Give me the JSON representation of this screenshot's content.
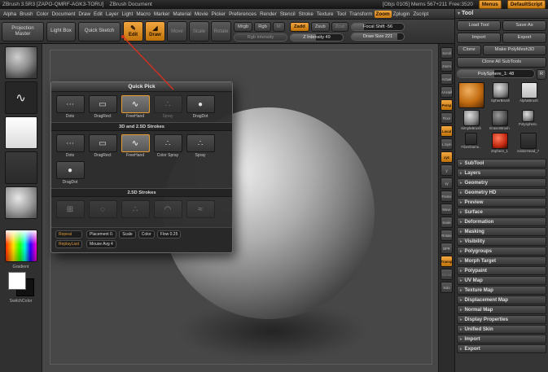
{
  "accent": "#e89a2a",
  "titlebar": {
    "title_left": "ZBrush 3.5R3 [ZAPO-QMRF-AGK3-TORU]",
    "title_doc": "ZBrush Document",
    "title_stats": "[Objs 0105] Mems 567+211 Free:3520",
    "menus_button": "Menus",
    "script_button": "DefaultScript"
  },
  "menubar": {
    "items": [
      {
        "label": "Alpha"
      },
      {
        "label": "Brush"
      },
      {
        "label": "Color"
      },
      {
        "label": "Document"
      },
      {
        "label": "Draw"
      },
      {
        "label": "Edit"
      },
      {
        "label": "Layer"
      },
      {
        "label": "Light"
      },
      {
        "label": "Macro"
      },
      {
        "label": "Marker"
      },
      {
        "label": "Material"
      },
      {
        "label": "Movie"
      },
      {
        "label": "Picker"
      },
      {
        "label": "Preferences"
      },
      {
        "label": "Render"
      },
      {
        "label": "Stencil"
      },
      {
        "label": "Stroke"
      },
      {
        "label": "Texture"
      },
      {
        "label": "Tool"
      },
      {
        "label": "Transform"
      },
      {
        "label": "Zoom",
        "cls": "active"
      },
      {
        "label": "Zplugin"
      },
      {
        "label": "Zscript"
      }
    ]
  },
  "toolbar": {
    "projection_master": "Projection Master",
    "light_box": "Light Box",
    "quick_sketch": "Quick Sketch",
    "modes": [
      {
        "label": "Edit",
        "glyph": "✎",
        "cls": "orange"
      },
      {
        "label": "Draw",
        "glyph": "◢",
        "cls": "orange"
      },
      {
        "label": "Move",
        "cls": "dim"
      },
      {
        "label": "Scale",
        "cls": "dim"
      },
      {
        "label": "Rotate",
        "cls": "dim"
      }
    ],
    "paint_buttons": [
      {
        "label": "Mrgb"
      },
      {
        "label": "Rgb"
      },
      {
        "label": "M",
        "cls": "dim"
      }
    ],
    "rgb_intensity": "Rgb Intensity",
    "sculpt_buttons": [
      {
        "label": "Zadd",
        "cls": "orange"
      },
      {
        "label": "Zsub"
      },
      {
        "label": "Zcut",
        "cls": "dim"
      }
    ],
    "z_intensity": "Z Intensity 49",
    "focal_shift": "Focal Shift -56",
    "draw_size": "Draw Size 221"
  },
  "left_shelf": {
    "stroke_glyph": "∿",
    "gradient_label": "Gradient",
    "switch_label": "SwitchColor"
  },
  "popup": {
    "title": "Quick Pick",
    "quick_row": [
      {
        "label": "Dots",
        "glyph": "⋯"
      },
      {
        "label": "DragRect",
        "glyph": "▭"
      },
      {
        "label": "FreeHand",
        "glyph": "∿",
        "cls": "selected"
      },
      {
        "label": "Spray",
        "glyph": "∴",
        "cls": "dim"
      },
      {
        "label": "DragDot",
        "glyph": "●"
      }
    ],
    "section_3d": "3D and 2.5D Strokes",
    "row_3d": [
      {
        "label": "Dots",
        "glyph": "⋯"
      },
      {
        "label": "DragRect",
        "glyph": "▭"
      },
      {
        "label": "FreeHand",
        "glyph": "∿",
        "cls": "selected"
      },
      {
        "label": "Color Spray",
        "glyph": "∴"
      },
      {
        "label": "Spray",
        "glyph": "∴"
      },
      {
        "label": "DragDot",
        "glyph": "●"
      }
    ],
    "section_25d": "2.5D Strokes",
    "row_25d": [
      {
        "label": "",
        "glyph": "⊞",
        "cls": "dim"
      },
      {
        "label": "",
        "glyph": "◌",
        "cls": "dim"
      },
      {
        "label": "",
        "glyph": "∴",
        "cls": "dim"
      },
      {
        "label": "",
        "glyph": "◠",
        "cls": "dim"
      },
      {
        "label": "",
        "glyph": "≈",
        "cls": "dim"
      }
    ],
    "footer": {
      "repeat": "Repeat",
      "replay": "ReplayLast",
      "placement": "Placement 0.",
      "scale": "Scale",
      "color": "Color",
      "flow": "Flow 0.25",
      "mouse_avg": "Mouse Avg 4"
    }
  },
  "right_strip": {
    "items": [
      {
        "label": "Scroll"
      },
      {
        "label": "Zoom"
      },
      {
        "label": "Actual"
      },
      {
        "label": "AAHalf"
      },
      {
        "label": "Persp",
        "cls": "active"
      },
      {
        "label": "Floor"
      },
      {
        "label": "Local",
        "cls": "active"
      },
      {
        "label": "L.Sym"
      },
      {
        "label": "xyz",
        "cls": "active"
      },
      {
        "label": "y"
      },
      {
        "label": "xy"
      },
      {
        "label": "Frame"
      },
      {
        "label": "Move"
      },
      {
        "label": "Scale"
      },
      {
        "label": "Rotate"
      },
      {
        "label": "BPR"
      },
      {
        "label": "Transp",
        "cls": "active"
      },
      {
        "label": "Ghost",
        "cls": "dim"
      },
      {
        "label": "Solo"
      }
    ]
  },
  "tool_panel": {
    "title": "Tool",
    "load_tool": "Load Tool",
    "save_as": "Save As",
    "import_btn": "Import",
    "export_btn": "Export",
    "clone": "Clone",
    "make_polymesh": "Make PolyMesh3D",
    "clone_all": "Clone All SubTools",
    "active_slider": "PolySphere_1: 48",
    "r_button": "R",
    "thumbs": [
      {
        "label": "",
        "cls": "big t-orange"
      },
      {
        "label": "SpherBrush",
        "cls": "t-sphere"
      },
      {
        "label": "AlphaBrush",
        "cls": "t-light"
      },
      {
        "label": "SimpleBrush",
        "cls": "t-sphere"
      },
      {
        "label": "EraserBrush",
        "cls": "t-darksphere"
      },
      {
        "label": "Polysphere.",
        "cls": "tiny t-sphere"
      },
      {
        "label": "FiberDame..",
        "cls": "tiny t-dark"
      },
      {
        "label": "Zsphere_1",
        "cls": "t-red"
      },
      {
        "label": "zoldorHead_7",
        "cls": "t-dark"
      }
    ],
    "sections": [
      {
        "label": "SubTool"
      },
      {
        "label": "Layers"
      },
      {
        "label": "Geometry"
      },
      {
        "label": "Geometry HD"
      },
      {
        "label": "Preview"
      },
      {
        "label": "Surface"
      },
      {
        "label": "Deformation"
      },
      {
        "label": "Masking"
      },
      {
        "label": "Visibility"
      },
      {
        "label": "Polygroups"
      },
      {
        "label": "Morph Target"
      },
      {
        "label": "Polypaint"
      },
      {
        "label": "UV Map"
      },
      {
        "label": "Texture Map"
      },
      {
        "label": "Displacement Map"
      },
      {
        "label": "Normal Map"
      },
      {
        "label": "Display Properties"
      },
      {
        "label": "Unified Skin"
      },
      {
        "label": "Import"
      },
      {
        "label": "Export"
      }
    ]
  }
}
